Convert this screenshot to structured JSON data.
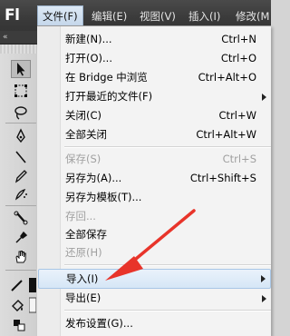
{
  "app": {
    "logo": "Fl"
  },
  "menubar": {
    "items": [
      "文件(F)",
      "编辑(E)",
      "视图(V)",
      "插入(I)",
      "修改(M"
    ]
  },
  "toolbox": {
    "header": "«",
    "tools": [
      "selection-tool",
      "free-transform-tool",
      "lasso-tool",
      "pen-tool",
      "line-tool",
      "pencil-tool",
      "spray-tool",
      "bone-tool",
      "eyedropper-tool",
      "hand-tool",
      "stroke-color",
      "fill-color",
      "swap-colors"
    ]
  },
  "file_menu": {
    "items": [
      {
        "label": "新建(N)...",
        "shortcut": "Ctrl+N",
        "disabled": false,
        "submenu": false
      },
      {
        "label": "打开(O)...",
        "shortcut": "Ctrl+O",
        "disabled": false,
        "submenu": false
      },
      {
        "label": "在 Bridge 中浏览",
        "shortcut": "Ctrl+Alt+O",
        "disabled": false,
        "submenu": false
      },
      {
        "label": "打开最近的文件(F)",
        "shortcut": "",
        "disabled": false,
        "submenu": true
      },
      {
        "label": "关闭(C)",
        "shortcut": "Ctrl+W",
        "disabled": false,
        "submenu": false
      },
      {
        "label": "全部关闭",
        "shortcut": "Ctrl+Alt+W",
        "disabled": false,
        "submenu": false
      },
      {
        "label": "保存(S)",
        "shortcut": "Ctrl+S",
        "disabled": true,
        "submenu": false
      },
      {
        "label": "另存为(A)...",
        "shortcut": "Ctrl+Shift+S",
        "disabled": false,
        "submenu": false
      },
      {
        "label": "另存为模板(T)...",
        "shortcut": "",
        "disabled": false,
        "submenu": false
      },
      {
        "label": "存回...",
        "shortcut": "",
        "disabled": true,
        "submenu": false
      },
      {
        "label": "全部保存",
        "shortcut": "",
        "disabled": false,
        "submenu": false
      },
      {
        "label": "还原(H)",
        "shortcut": "",
        "disabled": true,
        "submenu": false
      },
      {
        "label": "导入(I)",
        "shortcut": "",
        "disabled": false,
        "submenu": true,
        "highlighted": true
      },
      {
        "label": "导出(E)",
        "shortcut": "",
        "disabled": false,
        "submenu": true
      },
      {
        "label": "发布设置(G)...",
        "shortcut": "",
        "disabled": false,
        "submenu": false
      }
    ]
  },
  "colors": {
    "annotation_arrow": "#e8342a",
    "highlight": "#d6e6f6"
  }
}
